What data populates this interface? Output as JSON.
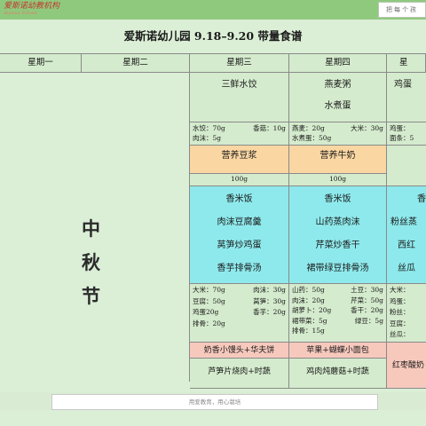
{
  "header": {
    "logo_text": "爱斯诺幼教机构",
    "logo_sub": "Aisinuo School",
    "watermark": "把每个孩"
  },
  "title": "爱斯诺幼儿园 9.18–9.20 带量食谱",
  "days": [
    "星期一",
    "星期二",
    "星期三",
    "星期四",
    "星"
  ],
  "festival": [
    "中",
    "秋",
    "节"
  ],
  "wed": {
    "breakfast": "三鲜水饺",
    "ing": [
      [
        "水饺：70g",
        "香菇：10g"
      ],
      [
        "肉沫：5g",
        ""
      ]
    ],
    "snack": "营养豆浆",
    "snack_qty": "100g",
    "lunch": [
      "香米饭",
      "肉沫豆腐羹",
      "莴笋炒鸡蛋",
      "香芋排骨汤"
    ],
    "lunch_ing": [
      [
        "大米：70g",
        "肉沫：30g"
      ],
      [
        "豆腐：50g",
        "莴笋：30g"
      ],
      [
        "鸡蛋20g",
        "香芋：20g"
      ],
      [
        "排骨：20g",
        ""
      ]
    ],
    "pm1": "奶香小馒头+华夫饼",
    "pm2": "芦笋片烧肉+时蔬"
  },
  "thu": {
    "breakfast1": "燕麦粥",
    "breakfast2": "水煮蛋",
    "ing": [
      [
        "燕麦：20g",
        "大米：30g"
      ],
      [
        "水煮蛋：50g",
        ""
      ]
    ],
    "snack": "营养牛奶",
    "snack_qty": "100g",
    "lunch": [
      "香米饭",
      "山药蒸肉沫",
      "芹菜炒香干",
      "裙带绿豆排骨汤"
    ],
    "lunch_ing": [
      [
        "山药：50g",
        "土豆：30g"
      ],
      [
        "肉沫：20g",
        "芹菜：50g"
      ],
      [
        "胡萝卜：20g",
        "香干：20g"
      ],
      [
        "裙带菜：5g",
        "绿豆：5g"
      ],
      [
        "排骨：15g",
        ""
      ]
    ],
    "pm1": "苹果+蝴蝶小面包",
    "pm2": "鸡肉炖蘑菇+时蔬"
  },
  "fri": {
    "breakfast": "鸡蛋",
    "ing": [
      "鸡蛋：",
      "面条：5"
    ],
    "lunch": [
      "香",
      "粉丝蒸",
      "西红",
      "丝瓜"
    ],
    "lunch_ing": [
      "大米：",
      "鸡蛋：",
      "粉丝：",
      "豆腐：",
      "丝瓜："
    ],
    "pm": "红枣酸奶"
  },
  "footer": "用爱教育，用心栽培"
}
